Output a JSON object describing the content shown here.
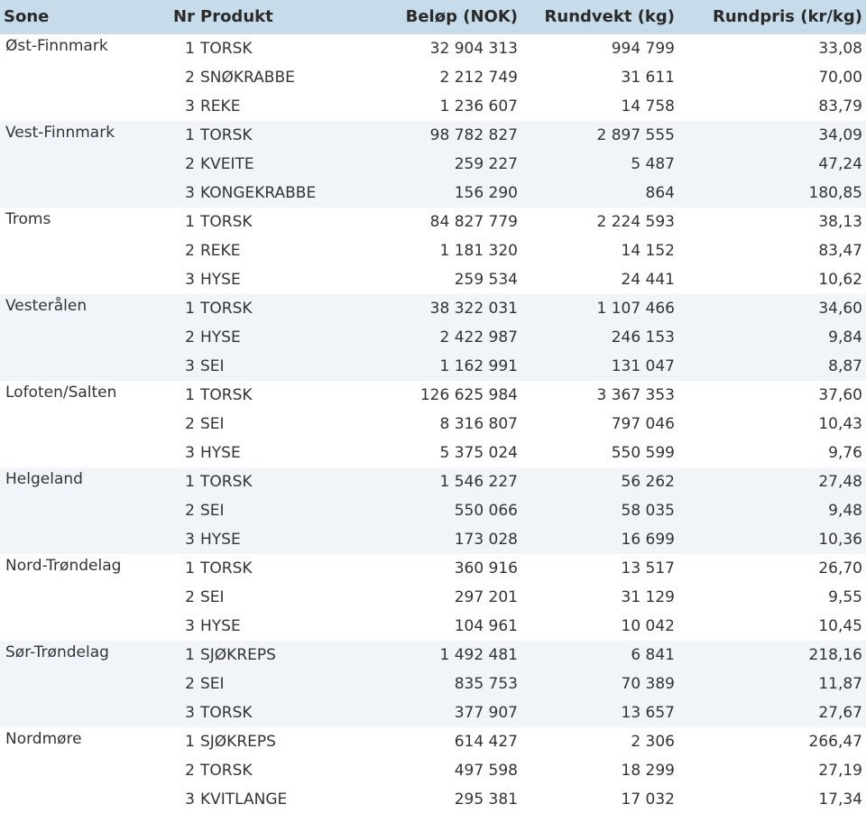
{
  "table": {
    "headers": {
      "sone": "Sone",
      "nr": "Nr",
      "produkt": "Produkt",
      "belop": "Beløp (NOK)",
      "rundvekt": "Rundvekt (kg)",
      "rundpris": "Rundpris (kr/kg)"
    },
    "zones": [
      {
        "name": "Øst-Finnmark",
        "rows": [
          {
            "nr": "1",
            "produkt": "TORSK",
            "belop": "32 904 313",
            "rundvekt": "994 799",
            "rundpris": "33,08"
          },
          {
            "nr": "2",
            "produkt": "SNØKRABBE",
            "belop": "2 212 749",
            "rundvekt": "31 611",
            "rundpris": "70,00"
          },
          {
            "nr": "3",
            "produkt": "REKE",
            "belop": "1 236 607",
            "rundvekt": "14 758",
            "rundpris": "83,79"
          }
        ]
      },
      {
        "name": "Vest-Finnmark",
        "rows": [
          {
            "nr": "1",
            "produkt": "TORSK",
            "belop": "98 782 827",
            "rundvekt": "2 897 555",
            "rundpris": "34,09"
          },
          {
            "nr": "2",
            "produkt": "KVEITE",
            "belop": "259 227",
            "rundvekt": "5 487",
            "rundpris": "47,24"
          },
          {
            "nr": "3",
            "produkt": "KONGEKRABBE",
            "belop": "156 290",
            "rundvekt": "864",
            "rundpris": "180,85"
          }
        ]
      },
      {
        "name": "Troms",
        "rows": [
          {
            "nr": "1",
            "produkt": "TORSK",
            "belop": "84 827 779",
            "rundvekt": "2 224 593",
            "rundpris": "38,13"
          },
          {
            "nr": "2",
            "produkt": "REKE",
            "belop": "1 181 320",
            "rundvekt": "14 152",
            "rundpris": "83,47"
          },
          {
            "nr": "3",
            "produkt": "HYSE",
            "belop": "259 534",
            "rundvekt": "24 441",
            "rundpris": "10,62"
          }
        ]
      },
      {
        "name": "Vesterålen",
        "rows": [
          {
            "nr": "1",
            "produkt": "TORSK",
            "belop": "38 322 031",
            "rundvekt": "1 107 466",
            "rundpris": "34,60"
          },
          {
            "nr": "2",
            "produkt": "HYSE",
            "belop": "2 422 987",
            "rundvekt": "246 153",
            "rundpris": "9,84"
          },
          {
            "nr": "3",
            "produkt": "SEI",
            "belop": "1 162 991",
            "rundvekt": "131 047",
            "rundpris": "8,87"
          }
        ]
      },
      {
        "name": "Lofoten/Salten",
        "rows": [
          {
            "nr": "1",
            "produkt": "TORSK",
            "belop": "126 625 984",
            "rundvekt": "3 367 353",
            "rundpris": "37,60"
          },
          {
            "nr": "2",
            "produkt": "SEI",
            "belop": "8 316 807",
            "rundvekt": "797 046",
            "rundpris": "10,43"
          },
          {
            "nr": "3",
            "produkt": "HYSE",
            "belop": "5 375 024",
            "rundvekt": "550 599",
            "rundpris": "9,76"
          }
        ]
      },
      {
        "name": "Helgeland",
        "rows": [
          {
            "nr": "1",
            "produkt": "TORSK",
            "belop": "1 546 227",
            "rundvekt": "56 262",
            "rundpris": "27,48"
          },
          {
            "nr": "2",
            "produkt": "SEI",
            "belop": "550 066",
            "rundvekt": "58 035",
            "rundpris": "9,48"
          },
          {
            "nr": "3",
            "produkt": "HYSE",
            "belop": "173 028",
            "rundvekt": "16 699",
            "rundpris": "10,36"
          }
        ]
      },
      {
        "name": "Nord-Trøndelag",
        "rows": [
          {
            "nr": "1",
            "produkt": "TORSK",
            "belop": "360 916",
            "rundvekt": "13 517",
            "rundpris": "26,70"
          },
          {
            "nr": "2",
            "produkt": "SEI",
            "belop": "297 201",
            "rundvekt": "31 129",
            "rundpris": "9,55"
          },
          {
            "nr": "3",
            "produkt": "HYSE",
            "belop": "104 961",
            "rundvekt": "10 042",
            "rundpris": "10,45"
          }
        ]
      },
      {
        "name": "Sør-Trøndelag",
        "rows": [
          {
            "nr": "1",
            "produkt": "SJØKREPS",
            "belop": "1 492 481",
            "rundvekt": "6 841",
            "rundpris": "218,16"
          },
          {
            "nr": "2",
            "produkt": "SEI",
            "belop": "835 753",
            "rundvekt": "70 389",
            "rundpris": "11,87"
          },
          {
            "nr": "3",
            "produkt": "TORSK",
            "belop": "377 907",
            "rundvekt": "13 657",
            "rundpris": "27,67"
          }
        ]
      },
      {
        "name": "Nordmøre",
        "rows": [
          {
            "nr": "1",
            "produkt": "SJØKREPS",
            "belop": "614 427",
            "rundvekt": "2 306",
            "rundpris": "266,47"
          },
          {
            "nr": "2",
            "produkt": "TORSK",
            "belop": "497 598",
            "rundvekt": "18 299",
            "rundpris": "27,19"
          },
          {
            "nr": "3",
            "produkt": "KVITLANGE",
            "belop": "295 381",
            "rundvekt": "17 032",
            "rundpris": "17,34"
          }
        ]
      }
    ]
  }
}
